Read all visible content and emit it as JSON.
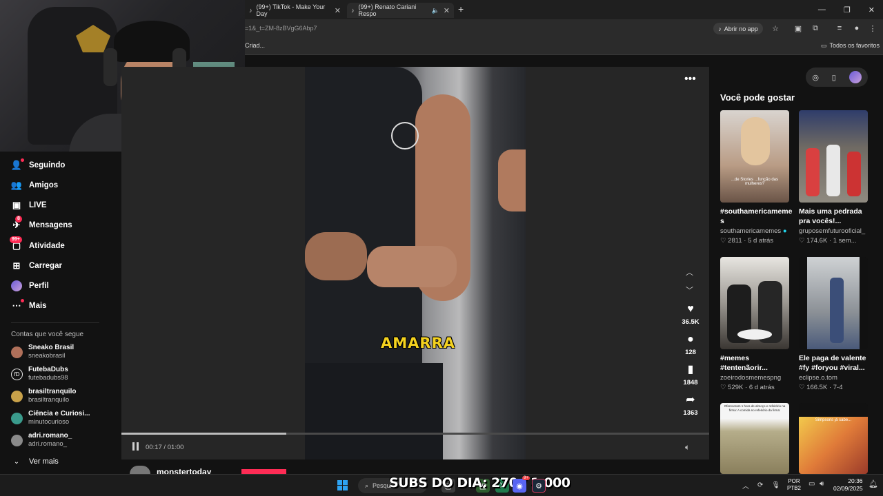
{
  "browser": {
    "tabs": [
      {
        "label": "(99+) TikTok - Make Your Day"
      },
      {
        "label": "(99+) Renato Cariani Respo"
      }
    ],
    "url": "=1&_t=ZM-8zBVgG6Abp7",
    "open_app_label": "Abrir no app",
    "bookmark_left": "Criad...",
    "bookmark_right": "Todos os favoritos"
  },
  "sidebar": {
    "items": [
      {
        "label": "Seguindo",
        "icon": "following-icon"
      },
      {
        "label": "Amigos",
        "icon": "friends-icon"
      },
      {
        "label": "LIVE",
        "icon": "live-icon"
      },
      {
        "label": "Mensagens",
        "icon": "messages-icon",
        "badge": "8"
      },
      {
        "label": "Atividade",
        "icon": "activity-icon",
        "badge": "99+"
      },
      {
        "label": "Carregar",
        "icon": "upload-icon"
      },
      {
        "label": "Perfil",
        "icon": "profile-avatar"
      },
      {
        "label": "Mais",
        "icon": "more-icon"
      }
    ],
    "following_title": "Contas que você segue",
    "accounts": [
      {
        "name": "Sneako Brasil",
        "handle": "sneakobrasil",
        "color": "#b0705a"
      },
      {
        "name": "FutebaDubs",
        "handle": "futebadubs98",
        "color": "#e6e6e6"
      },
      {
        "name": "brasiltranquilo",
        "handle": "brasiltranquilo",
        "color": "#c9a24a"
      },
      {
        "name": "Ciência e Curiosi...",
        "handle": "minutocurioso",
        "color": "#3a9b8c"
      },
      {
        "name": "adri.romano_",
        "handle": "adri.romano_",
        "color": "#8a8a8a"
      }
    ],
    "see_more": "Ver mais"
  },
  "player": {
    "caption": "AMARRA",
    "time": "00:17 / 01:00",
    "progress": 0.28,
    "likes": "36.5K",
    "comments": "128",
    "saves": "1848",
    "shares": "1363",
    "author": "monstertoday"
  },
  "suggestions": {
    "title": "Você pode gostar",
    "cards": [
      {
        "title": "#southamericameme s",
        "author": "southamericamemes",
        "verified": true,
        "likes": "2811",
        "age": "5 d atrás",
        "thumb_text": "...de Stories ...função das mulheres?"
      },
      {
        "title": "Mais uma pedrada pra vocês!...",
        "author": "gruposemfuturooficial_",
        "verified": false,
        "likes": "174.6K",
        "age": "1 sem...",
        "thumb_text": ""
      },
      {
        "title": "#memes #tentenãorir...",
        "author": "zoeirodosmemespng",
        "verified": false,
        "likes": "529K",
        "age": "6 d atrás",
        "thumb_text": ""
      },
      {
        "title": "Ele paga de valente #fy #foryou #viral...",
        "author": "eclipse.o.tom",
        "verified": false,
        "likes": "166.5K",
        "age": "7-4",
        "thumb_text": ""
      },
      {
        "title": "",
        "author": "",
        "verified": false,
        "likes": "",
        "age": "",
        "thumb_text": "Ofereceram 1 hora de almoço e refeitório na firma: A comida no refeitório da firma:"
      },
      {
        "title": "",
        "author": "",
        "verified": false,
        "likes": "",
        "age": "",
        "thumb_text": "Simpsons já sabe..."
      }
    ]
  },
  "taskbar": {
    "search_placeholder": "Pesqui",
    "overlay_text": "SUBS DO DIA: 270 / 1.000",
    "discord_badge": "9+",
    "lang": "POR",
    "layout": "PTB2",
    "time": "20:36",
    "date": "02/09/2025"
  }
}
